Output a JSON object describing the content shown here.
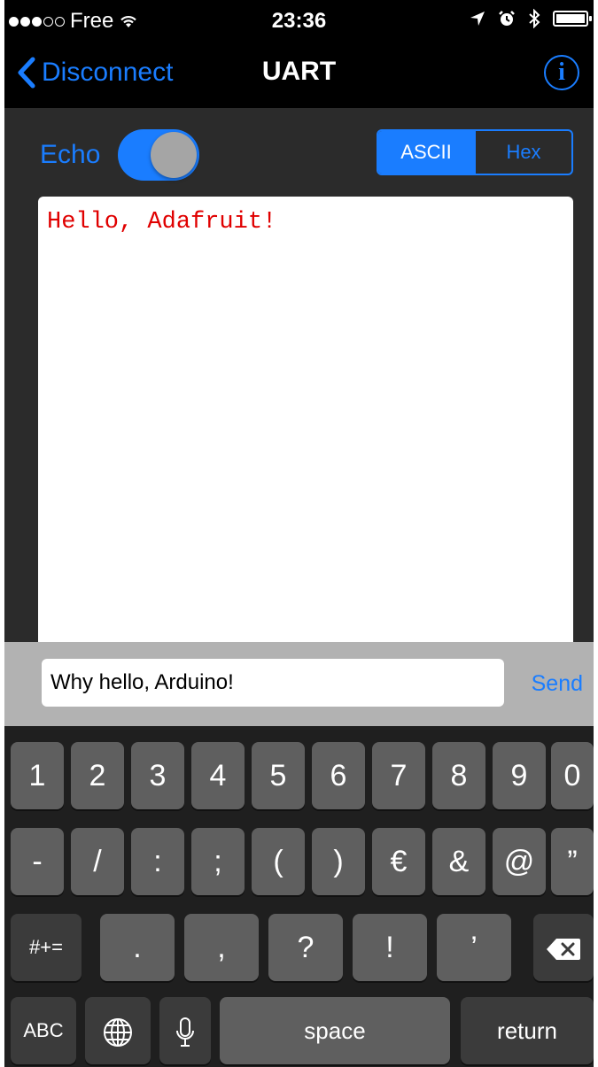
{
  "status_bar": {
    "carrier": "Free",
    "time": "23:36"
  },
  "nav": {
    "back_label": "Disconnect",
    "title": "UART"
  },
  "controls": {
    "echo_label": "Echo",
    "echo_on": true,
    "segments": [
      "ASCII",
      "Hex"
    ],
    "selected_segment": "ASCII"
  },
  "console": {
    "text": "Hello, Adafruit!"
  },
  "input": {
    "value": "Why hello, Arduino!",
    "send_label": "Send"
  },
  "keyboard": {
    "row1": [
      "1",
      "2",
      "3",
      "4",
      "5",
      "6",
      "7",
      "8",
      "9",
      "0"
    ],
    "row2": [
      "-",
      "/",
      ":",
      ";",
      "(",
      ")",
      "€",
      "&",
      "@",
      "”"
    ],
    "row3": {
      "shift_label": "#+=",
      "keys": [
        ".",
        ",",
        "?",
        "!",
        "’"
      ]
    },
    "row4": {
      "abc_label": "ABC",
      "space_label": "space",
      "return_label": "return"
    }
  },
  "colors": {
    "accent": "#1a7dff",
    "console_text": "#e00000"
  }
}
